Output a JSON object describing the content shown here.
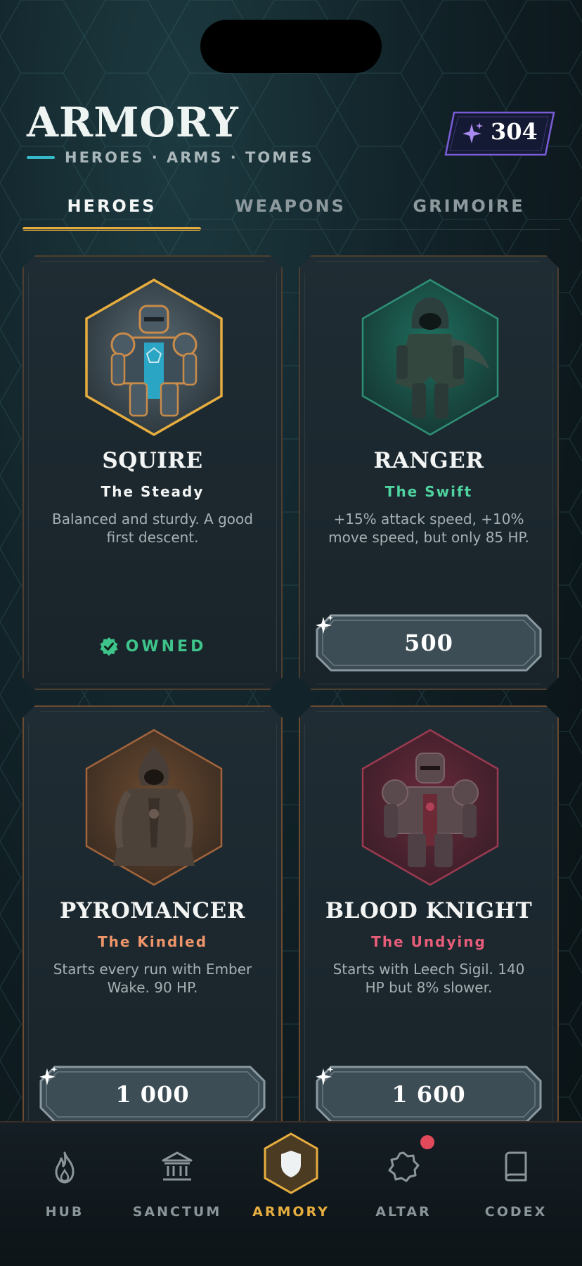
{
  "header": {
    "title": "ARMORY",
    "subtitle": "HEROES · ARMS · TOMES",
    "currency": {
      "icon": "sparkle-icon",
      "value": "304"
    }
  },
  "tabs": [
    {
      "label": "HEROES",
      "active": true
    },
    {
      "label": "WEAPONS",
      "active": false
    },
    {
      "label": "GRIMOIRE",
      "active": false
    }
  ],
  "heroes": [
    {
      "name": "SQUIRE",
      "tagline": "The Steady",
      "desc": "Balanced and sturdy. A good first descent.",
      "status": "OWNED",
      "tag_color": "#f3f5f4",
      "frame_color": "#e7ae3f"
    },
    {
      "name": "RANGER",
      "tagline": "The Swift",
      "desc": "+15% attack speed, +10% move speed, but only 85 HP.",
      "price": "500",
      "tag_color": "#4fd3a0",
      "frame_color": "#2f8f76"
    },
    {
      "name": "PYROMANCER",
      "tagline": "The Kindled",
      "desc": "Starts every run with Ember Wake. 90 HP.",
      "price": "1 000",
      "tag_color": "#f0956a",
      "frame_color": "#a2643c"
    },
    {
      "name": "BLOOD KNIGHT",
      "tagline": "The Undying",
      "desc": "Starts with Leech Sigil. 140 HP but 8% slower.",
      "price": "1 600",
      "tag_color": "#e85d7a",
      "frame_color": "#9a3a50"
    }
  ],
  "nav": [
    {
      "label": "HUB",
      "icon": "flame-icon"
    },
    {
      "label": "SANCTUM",
      "icon": "temple-icon"
    },
    {
      "label": "ARMORY",
      "icon": "shield-icon",
      "active": true
    },
    {
      "label": "ALTAR",
      "icon": "seal-icon",
      "badge": true
    },
    {
      "label": "CODEX",
      "icon": "book-icon"
    }
  ],
  "colors": {
    "accent": "#e7ae3f",
    "owned": "#3ec48a",
    "currency_frame": "#7a5cd6",
    "badge": "#e24a5c"
  }
}
